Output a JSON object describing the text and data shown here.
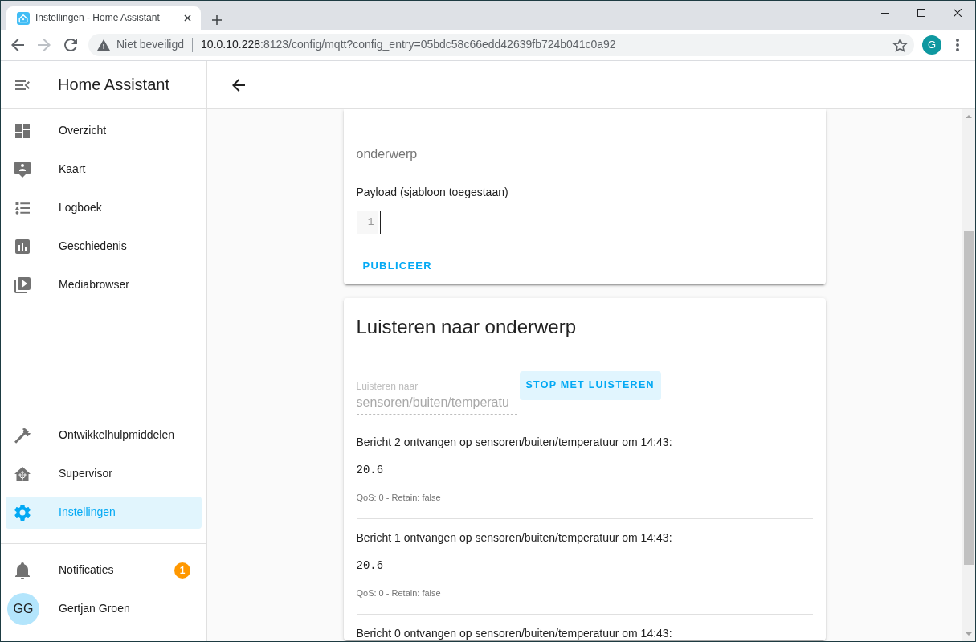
{
  "browser": {
    "tab": {
      "title": "Instellingen - Home Assistant"
    },
    "nav": [
      {
        "kind": "back",
        "disabled": false
      },
      {
        "kind": "forward",
        "disabled": true
      },
      {
        "kind": "reload",
        "disabled": false
      }
    ],
    "address_bar": {
      "security": "Niet beveiligd",
      "host": "10.0.10.228",
      "path": ":8123/config/mqtt?config_entry=05bdc58c66edd42639fb724b041c0a92"
    },
    "profile": {
      "initial": "G"
    }
  },
  "sidebar": {
    "title": "Home Assistant",
    "items": [
      {
        "label": "Overzicht",
        "selected": false
      },
      {
        "label": "Kaart",
        "selected": false
      },
      {
        "label": "Logboek",
        "selected": false
      },
      {
        "label": "Geschiedenis",
        "selected": false
      },
      {
        "label": "Mediabrowser",
        "selected": false
      }
    ],
    "bottom_items": [
      {
        "label": "Ontwikkelhulpmiddelen",
        "selected": false
      },
      {
        "label": "Supervisor",
        "selected": false
      },
      {
        "label": "Instellingen",
        "selected": true
      }
    ],
    "notifications": {
      "label": "Notificaties",
      "badge": "1"
    },
    "user": {
      "initials": "GG",
      "name": "Gertjan Groen"
    }
  },
  "publish_card": {
    "topic_field": {
      "placeholder": "onderwerp"
    },
    "payload_label": "Payload (sjabloon toegestaan)",
    "editor": {
      "line_numbers": [
        "1"
      ]
    },
    "button": "PUBLICEER"
  },
  "listen_card": {
    "title": "Luisteren naar onderwerp",
    "topic_field": {
      "label": "Luisteren naar",
      "value": "sensoren/buiten/temperatu",
      "disabled": true
    },
    "button": "STOP MET LUISTEREN",
    "messages": [
      {
        "header": "Bericht 2 ontvangen op sensoren/buiten/temperatuur om 14:43:",
        "payload": "20.6",
        "meta": "QoS: 0 - Retain: false"
      },
      {
        "header": "Bericht 1 ontvangen op sensoren/buiten/temperatuur om 14:43:",
        "payload": "20.6",
        "meta": "QoS: 0 - Retain: false"
      },
      {
        "header": "Bericht 0 ontvangen op sensoren/buiten/temperatuur om 14:43:"
      }
    ]
  }
}
